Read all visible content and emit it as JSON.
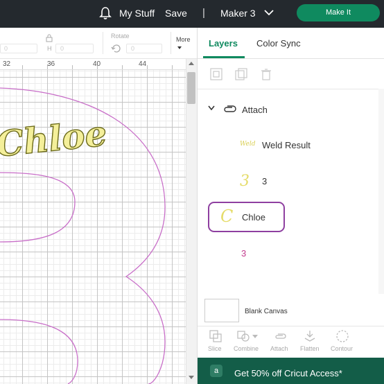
{
  "header": {
    "bell_icon": "bell-icon",
    "my_stuff": "My Stuff",
    "save": "Save",
    "separator": "|",
    "machine": "Maker 3",
    "make_it": "Make It"
  },
  "toolbar": {
    "w_value": "0",
    "h_label": "H",
    "h_value": "0",
    "rotate_label": "Rotate",
    "rotate_value": "0",
    "more_label": "More"
  },
  "ruler": {
    "labels": [
      "32",
      "36",
      "40",
      "44"
    ]
  },
  "canvas": {
    "text_layer": "Chloe",
    "colors": {
      "text_fill": "#f4ef9a",
      "text_stroke": "#6b6a1a",
      "number_outline": "#c86ec8"
    }
  },
  "panel": {
    "tabs": [
      "Layers",
      "Color Sync"
    ],
    "layers": {
      "group_name": "Attach",
      "items": [
        {
          "thumb_text": "Weld",
          "label": "Weld Result"
        },
        {
          "thumb_text": "3",
          "label": "3"
        },
        {
          "thumb_text": "C",
          "label": "Chloe"
        },
        {
          "thumb_text": "",
          "label": "3"
        }
      ]
    },
    "blank_canvas_label": "Blank Canvas",
    "actions": [
      "Slice",
      "Combine",
      "Attach",
      "Flatten",
      "Contour"
    ]
  },
  "promo": {
    "logo": "a",
    "text": "Get 50% off Cricut Access*"
  },
  "colors": {
    "header_bg": "#24292e",
    "accent_green": "#0f8a5f",
    "promo_bg": "#135d48",
    "highlight_purple": "#8e3fa0"
  }
}
